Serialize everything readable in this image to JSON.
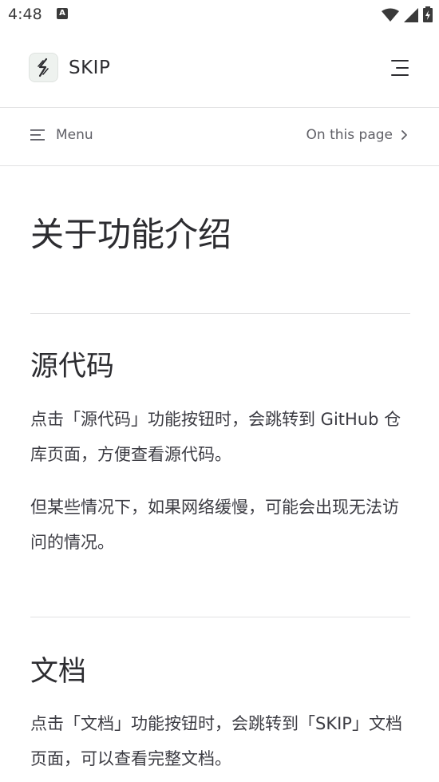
{
  "status_bar": {
    "time": "4:48",
    "notif_letter": "A"
  },
  "nav": {
    "site_title": "SKIP"
  },
  "local_nav": {
    "menu_label": "Menu",
    "on_this_page_label": "On this page"
  },
  "doc": {
    "title": "关于功能介绍",
    "sections": [
      {
        "heading": "源代码",
        "paragraphs": [
          "点击「源代码」功能按钮时，会跳转到 GitHub 仓库页面，方便查看源代码。",
          "但某些情况下，如果网络缓慢，可能会出现无法访问的情况。"
        ]
      },
      {
        "heading": "文档",
        "paragraphs": [
          "点击「文档」功能按钮时，会跳转到「SKIP」文档页面，可以查看完整文档。"
        ]
      }
    ]
  }
}
